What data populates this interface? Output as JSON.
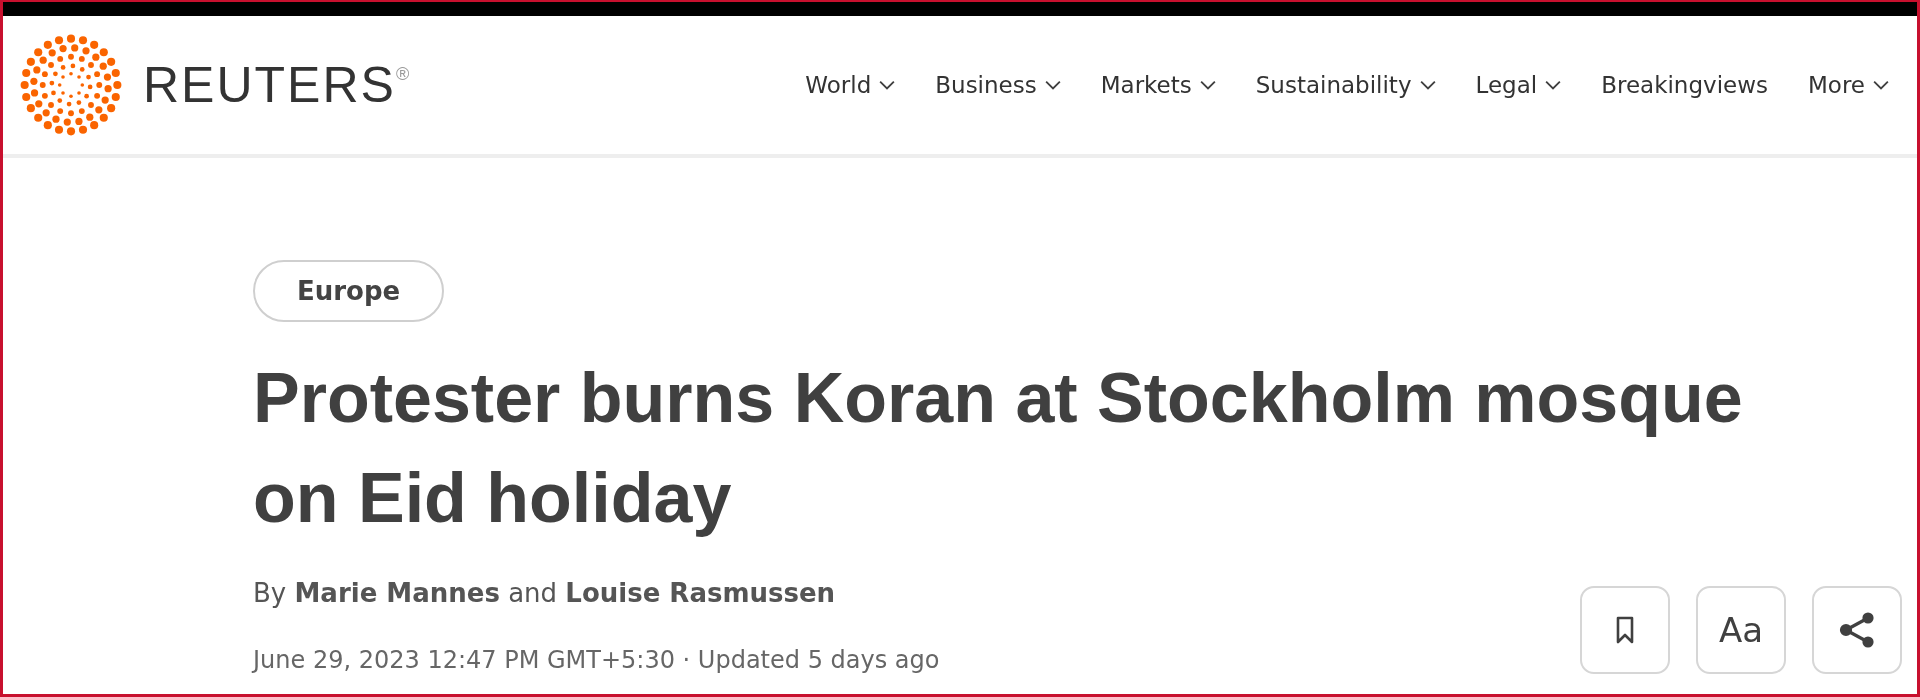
{
  "header": {
    "brand": "REUTERS$^{®}$",
    "nav": [
      {
        "label": "World",
        "dropdown": true
      },
      {
        "label": "Business",
        "dropdown": true
      },
      {
        "label": "Markets",
        "dropdown": true
      },
      {
        "label": "Sustainability",
        "dropdown": true
      },
      {
        "label": "Legal",
        "dropdown": true
      },
      {
        "label": "Breakingviews",
        "dropdown": false
      },
      {
        "label": "More",
        "dropdown": true
      }
    ]
  },
  "article": {
    "section": "Europe",
    "headline": "Protester burns Koran at Stockholm mosque on Eid holiday",
    "byline": "By **Marie Mannes** and **Louise Rasmussen**",
    "dateline": "June 29, 2023 12:47 PM GMT+5:30 · Updated 5 days ago",
    "actions": [
      {
        "kind": "bookmark"
      },
      {
        "kind": "text",
        "label": "Aa"
      },
      {
        "kind": "share"
      }
    ]
  }
}
